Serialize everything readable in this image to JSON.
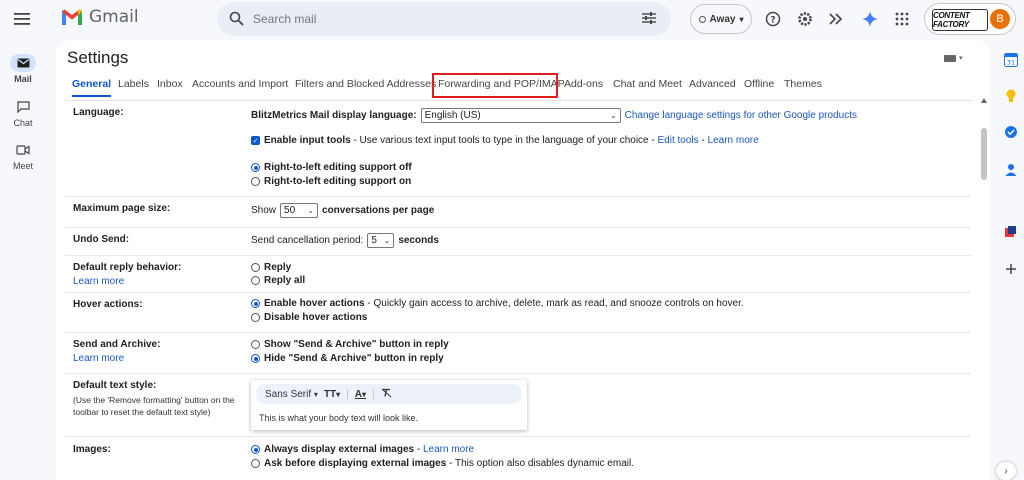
{
  "header": {
    "app_name": "Gmail",
    "search_placeholder": "Search mail",
    "status": "Away",
    "avatar_letter": "B",
    "brand_text": "CONTENT FACTORY"
  },
  "rail": {
    "items": [
      {
        "label": "Mail",
        "icon": "mail-icon",
        "active": true
      },
      {
        "label": "Chat",
        "icon": "chat-icon"
      },
      {
        "label": "Meet",
        "icon": "video-icon"
      }
    ]
  },
  "settings": {
    "title": "Settings",
    "tabs": [
      "General",
      "Labels",
      "Inbox",
      "Accounts and Import",
      "Filters and Blocked Addresses",
      "Forwarding and POP/IMAP",
      "Add-ons",
      "Chat and Meet",
      "Advanced",
      "Offline",
      "Themes"
    ],
    "active_tab": "General",
    "highlighted_tab": "Forwarding and POP/IMAP"
  },
  "language": {
    "label": "Language:",
    "display_label": "BlitzMetrics Mail display language:",
    "value": "English (US)",
    "change_link": "Change language settings for other Google products",
    "input_tools_bold": "Enable input tools",
    "input_tools_text": " - Use various text input tools to type in the language of your choice - ",
    "edit_tools": "Edit tools",
    "sep": " - ",
    "learn_more": "Learn more",
    "rtl_off": "Right-to-left editing support off",
    "rtl_on": "Right-to-left editing support on"
  },
  "page_size": {
    "label": "Maximum page size:",
    "show": "Show",
    "value": "50",
    "suffix": "conversations per page"
  },
  "undo": {
    "label": "Undo Send:",
    "prefix": "Send cancellation period:",
    "value": "5",
    "suffix": "seconds"
  },
  "reply": {
    "label": "Default reply behavior:",
    "learn_more": "Learn more",
    "opt1": "Reply",
    "opt2": "Reply all"
  },
  "hover": {
    "label": "Hover actions:",
    "enable": "Enable hover actions",
    "enable_desc": " - Quickly gain access to archive, delete, mark as read, and snooze controls on hover.",
    "disable": "Disable hover actions"
  },
  "send_archive": {
    "label": "Send and Archive:",
    "learn_more": "Learn more",
    "show": "Show \"Send & Archive\" button in reply",
    "hide": "Hide \"Send & Archive\" button in reply"
  },
  "text_style": {
    "label": "Default text style:",
    "help": "(Use the 'Remove formatting' button on the toolbar to reset the default text style)",
    "font": "Sans Serif",
    "size_glyph": "TT",
    "color_glyph": "A",
    "sample": "This is what your body text will look like."
  },
  "images": {
    "label": "Images:",
    "always": "Always display external images",
    "sep": " - ",
    "learn_more": "Learn more",
    "ask": "Ask before displaying external images",
    "ask_desc": " - This option also disables dynamic email."
  }
}
